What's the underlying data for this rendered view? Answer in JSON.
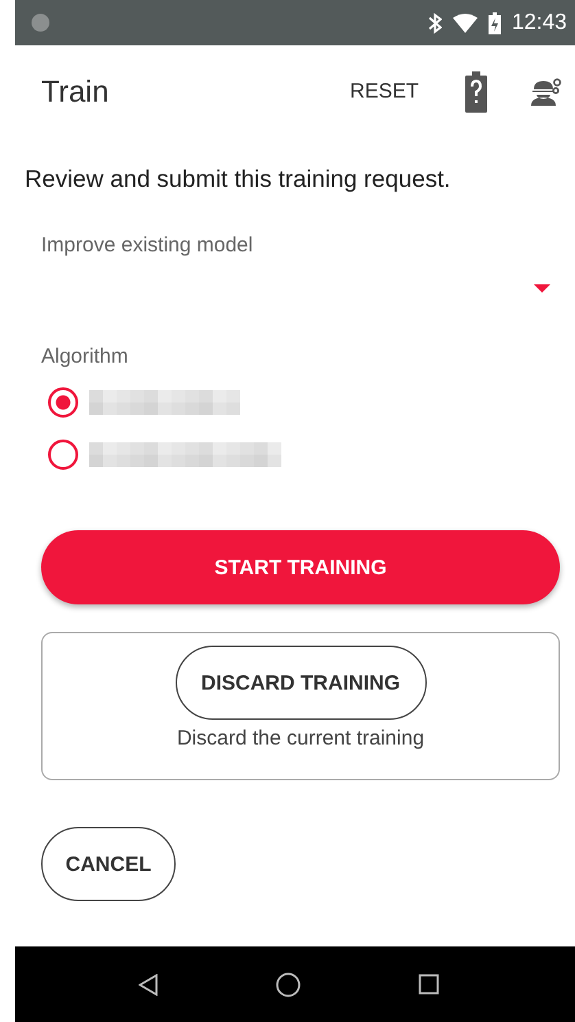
{
  "status_bar": {
    "time": "12:43"
  },
  "app_bar": {
    "title": "Train",
    "action": "RESET"
  },
  "instruction": "Review and submit this training request.",
  "model_field": {
    "label": "Improve existing model"
  },
  "algorithm": {
    "label": "Algorithm",
    "options": [
      {
        "selected": true
      },
      {
        "selected": false
      }
    ]
  },
  "start_button": "START TRAINING",
  "discard_card": {
    "button": "DISCARD TRAINING",
    "caption": "Discard the current training"
  },
  "cancel_button": "CANCEL"
}
